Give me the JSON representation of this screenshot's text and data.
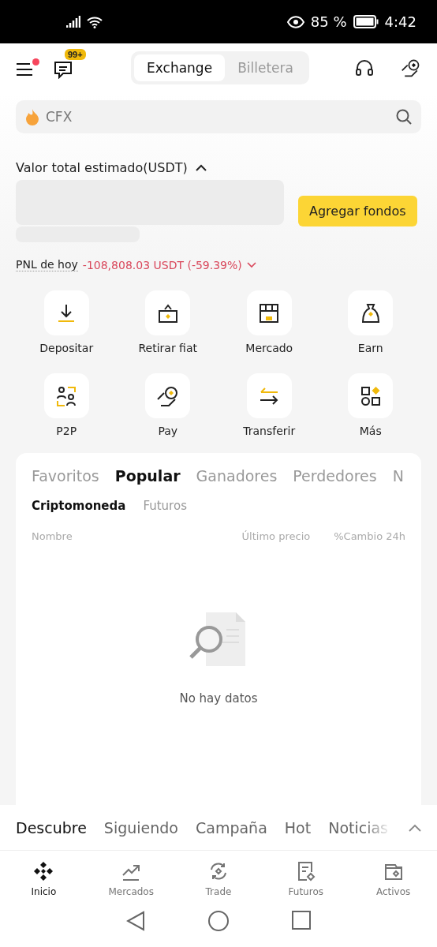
{
  "status_bar": {
    "battery": "85 %",
    "time": "4:42"
  },
  "header": {
    "badge": "99+",
    "notification_dot": true,
    "segments": [
      {
        "label": "Exchange",
        "selected": true
      },
      {
        "label": "Billetera",
        "selected": false
      }
    ]
  },
  "search": {
    "placeholder": "CFX"
  },
  "balance": {
    "title": "Valor total estimado(USDT)",
    "expanded": true,
    "button": "Agregar fondos",
    "pnl_label": "PNL de hoy",
    "pnl_value": "-108,808.03 USDT (-59.39%)"
  },
  "actions": [
    {
      "label": "Depositar"
    },
    {
      "label": "Retirar fiat"
    },
    {
      "label": "Mercado"
    },
    {
      "label": "Earn"
    },
    {
      "label": "P2P"
    },
    {
      "label": "Pay"
    },
    {
      "label": "Transferir"
    },
    {
      "label": "Más"
    }
  ],
  "market": {
    "tabs": [
      {
        "label": "Favoritos",
        "selected": false
      },
      {
        "label": "Popular",
        "selected": true
      },
      {
        "label": "Ganadores",
        "selected": false
      },
      {
        "label": "Perdedores",
        "selected": false
      },
      {
        "label": "N",
        "selected": false
      }
    ],
    "subtabs": [
      {
        "label": "Criptomoneda",
        "selected": true
      },
      {
        "label": "Futuros",
        "selected": false
      }
    ],
    "columns": [
      "Nombre",
      "Último precio",
      "%Cambio 24h"
    ],
    "empty": "No hay datos"
  },
  "feed_tabs": [
    {
      "label": "Descubre",
      "selected": true
    },
    {
      "label": "Siguiendo",
      "selected": false
    },
    {
      "label": "Campaña",
      "selected": false
    },
    {
      "label": "Hot",
      "selected": false
    },
    {
      "label": "Noticias",
      "selected": false
    }
  ],
  "nav": [
    {
      "label": "Inicio",
      "selected": true
    },
    {
      "label": "Mercados",
      "selected": false
    },
    {
      "label": "Trade",
      "selected": false
    },
    {
      "label": "Futuros",
      "selected": false
    },
    {
      "label": "Activos",
      "selected": false
    }
  ]
}
